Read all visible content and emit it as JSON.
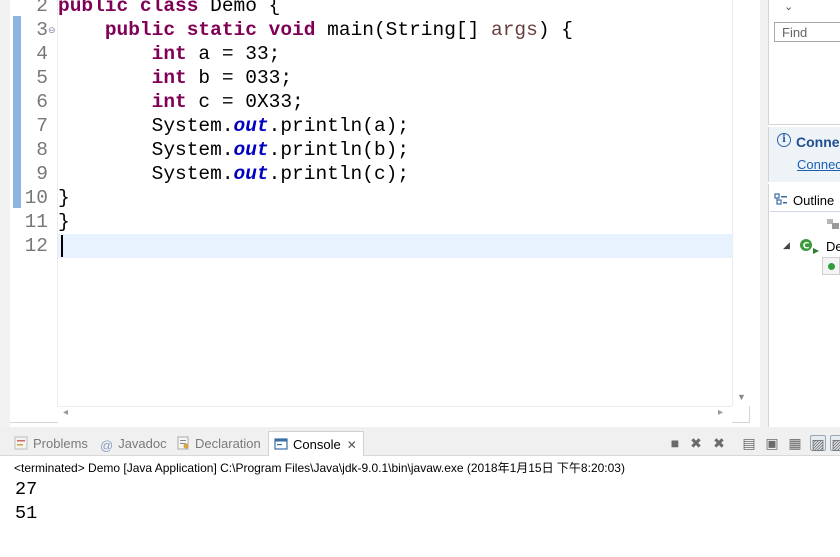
{
  "editor": {
    "lines": [
      {
        "num": "2",
        "tokens": [
          {
            "t": "public",
            "c": "kw"
          },
          {
            "t": " "
          },
          {
            "t": "class",
            "c": "kw"
          },
          {
            "t": " Demo {"
          }
        ]
      },
      {
        "num": "3",
        "fold": true,
        "tokens": [
          {
            "t": "    "
          },
          {
            "t": "public",
            "c": "kw"
          },
          {
            "t": " "
          },
          {
            "t": "static",
            "c": "kw"
          },
          {
            "t": " "
          },
          {
            "t": "void",
            "c": "kw"
          },
          {
            "t": " main(String[] "
          },
          {
            "t": "args",
            "c": "par"
          },
          {
            "t": ") {"
          }
        ]
      },
      {
        "num": "4",
        "tokens": [
          {
            "t": "        "
          },
          {
            "t": "int",
            "c": "kw"
          },
          {
            "t": " a = 33;"
          }
        ]
      },
      {
        "num": "5",
        "tokens": [
          {
            "t": "        "
          },
          {
            "t": "int",
            "c": "kw"
          },
          {
            "t": " b = 033;"
          }
        ]
      },
      {
        "num": "6",
        "tokens": [
          {
            "t": "        "
          },
          {
            "t": "int",
            "c": "kw"
          },
          {
            "t": " c = 0X33;"
          }
        ]
      },
      {
        "num": "7",
        "tokens": [
          {
            "t": "        System."
          },
          {
            "t": "out",
            "c": "fld"
          },
          {
            "t": ".println(a);"
          }
        ]
      },
      {
        "num": "8",
        "tokens": [
          {
            "t": "        System."
          },
          {
            "t": "out",
            "c": "fld"
          },
          {
            "t": ".println(b);"
          }
        ]
      },
      {
        "num": "9",
        "tokens": [
          {
            "t": "        System."
          },
          {
            "t": "out",
            "c": "fld"
          },
          {
            "t": ".println(c);"
          }
        ]
      },
      {
        "num": "10",
        "tokens": [
          {
            "t": "}"
          }
        ]
      },
      {
        "num": "11",
        "tokens": [
          {
            "t": "}"
          }
        ]
      },
      {
        "num": "12",
        "current": true,
        "tokens": []
      }
    ]
  },
  "task_view": {
    "find_placeholder": "Find"
  },
  "connect_view": {
    "title": "Conne",
    "link": "Connec"
  },
  "outline": {
    "tab_label": "Outline",
    "class_label": "De"
  },
  "console": {
    "tabs": {
      "problems": "Problems",
      "javadoc": "Javadoc",
      "declaration": "Declaration",
      "console": "Console"
    },
    "status": "<terminated> Demo [Java Application] C:\\Program Files\\Java\\jdk-9.0.1\\bin\\javaw.exe (2018年1月15日 下午8:20:03)",
    "output": [
      "27",
      "51"
    ]
  },
  "colors": {
    "keyword": "#7f0055",
    "static_field": "#0000c0",
    "parameter": "#6a3e3e",
    "current_line": "#e8f2fe",
    "change_bar": "#8cb5e0"
  }
}
